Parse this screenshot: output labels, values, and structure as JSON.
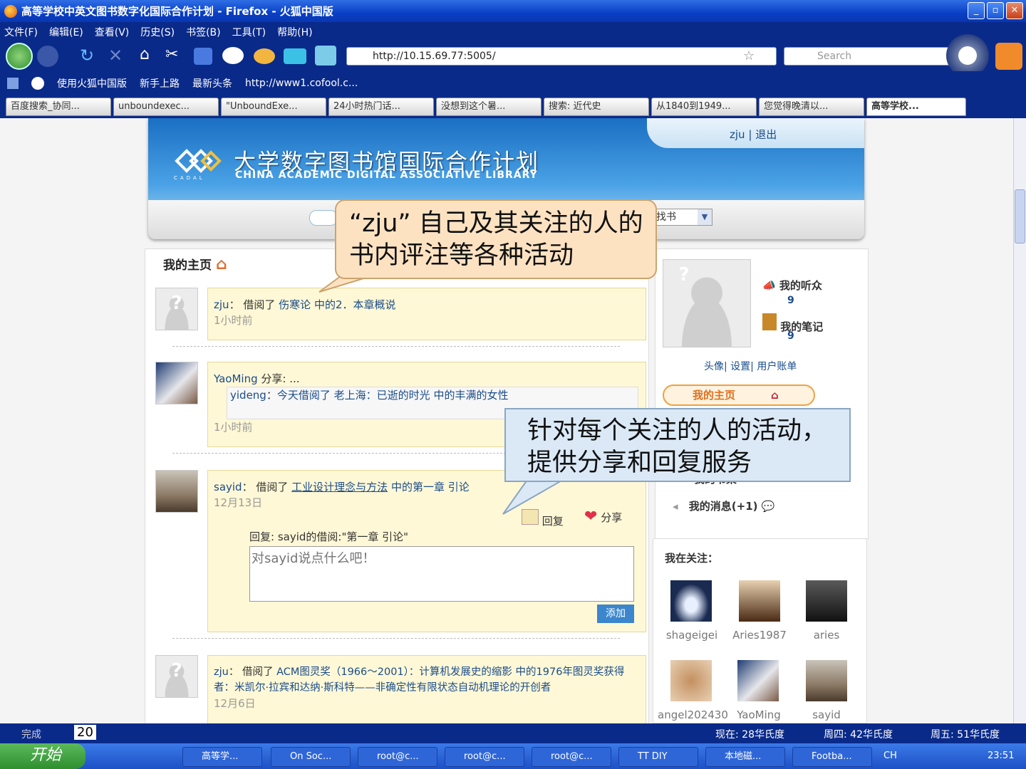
{
  "window": {
    "title": "高等学校中英文图书数字化国际合作计划 - Firefox - 火狐中国版"
  },
  "menu": [
    "文件(F)",
    "编辑(E)",
    "查看(V)",
    "历史(S)",
    "书签(B)",
    "工具(T)",
    "帮助(H)"
  ],
  "address": {
    "url": "http://10.15.69.77:5005/",
    "search_placeholder": "Search"
  },
  "bookmarks": [
    "使用火狐中国版",
    "新手上路",
    "最新头条",
    "http://www1.cofool.c..."
  ],
  "tabs": [
    "百度搜索_协同...",
    "unboundexec...",
    "\"UnboundExe...",
    "24小时热门话...",
    "没想到这个暑...",
    "搜索: 近代史",
    "从1840到1949...",
    "您觉得晚清以...",
    "高等学校..."
  ],
  "site": {
    "user_name": "zju",
    "logout": "退出",
    "separator": "|",
    "logo_cn": "大学数字图书馆国际合作计划",
    "logo_en": "CHINA ACADEMIC DIGITAL ASSOCIATIVE LIBRARY",
    "logo_abbr": "CADAL",
    "search_select": "找书",
    "home_title": "我的主页"
  },
  "feed": [
    {
      "user": "zju",
      "action": "借阅了",
      "book": "伤寒论",
      "suffix": "中的2．本章概说",
      "time": "1小时前"
    },
    {
      "user": "YaoMing",
      "action": "分享: ...",
      "inner_user": "yideng",
      "inner_action": "今天借阅了",
      "inner_book": "老上海：已逝的时光",
      "inner_suffix": "中的丰满的女性",
      "time": "1小时前"
    },
    {
      "user": "sayid",
      "action": "借阅了",
      "book": "工业设计理念与方法",
      "suffix": "中的第一章 引论",
      "time": "12月13日",
      "reply_label": "回复",
      "share_label": "分享",
      "reply_to": "回复: sayid的借阅:\"第一章 引论\"",
      "reply_placeholder": "对sayid说点什么吧！",
      "add_label": "添加"
    },
    {
      "user": "zju",
      "action": "借阅了",
      "book": "ACM图灵奖（1966～2001）：计算机发展史的缩影",
      "suffix": "中的1976年图灵奖获得者：米凯尔·拉宾和达纳·斯科特——非确定性有限状态自动机理论的开创者",
      "time": "12月6日"
    }
  ],
  "sidebar": {
    "listeners_label": "我的听众",
    "listeners_count": "9",
    "notes_label": "我的笔记",
    "notes_count": "9",
    "links": [
      "头像",
      "设置",
      "用户账单"
    ],
    "home_btn": "我的主页",
    "bookshelf": "我的书架",
    "messages": "我的消息(+1)",
    "following_title": "我在关注：",
    "following": [
      "shageigei",
      "Aries1987",
      "aries",
      "angel202430",
      "YaoMing",
      "sayid"
    ]
  },
  "callouts": {
    "c1": "“zju” 自己及其关注的人的书内评注等各种活动",
    "c2": "针对每个关注的人的活动，提供分享和回复服务"
  },
  "status": {
    "done": "完成",
    "page": "20",
    "w1": "现在: 28华氏度",
    "w2": "周四: 42华氏度",
    "w3": "周五: 51华氏度"
  },
  "taskbar": {
    "start": "开始",
    "items": [
      "高等学...",
      "On Soc...",
      "root@c...",
      "root@c...",
      "root@c...",
      "TT DIY",
      "本地磁...",
      "Footba..."
    ],
    "lang": "CH",
    "clock": "23:51"
  },
  "colors": {
    "accent": "#1a4c8a",
    "card": "#fff8d6",
    "xpblue": "#0a2a8a"
  }
}
